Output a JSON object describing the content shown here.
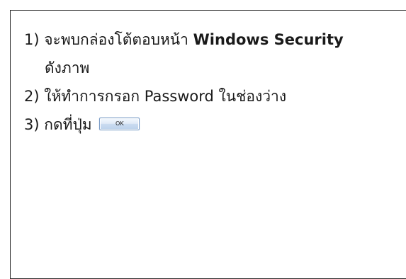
{
  "steps": [
    {
      "number": "1)",
      "text": "จะพบกล่องโต้ตอบหน้า",
      "emphasis": "Windows Security",
      "continuation": "ดังภาพ"
    },
    {
      "number": "2)",
      "text": "ให้ทำการกรอก Password ในช่องว่าง"
    },
    {
      "number": "3)",
      "text": "กดที่ปุ่ม",
      "button_label": "OK"
    }
  ]
}
